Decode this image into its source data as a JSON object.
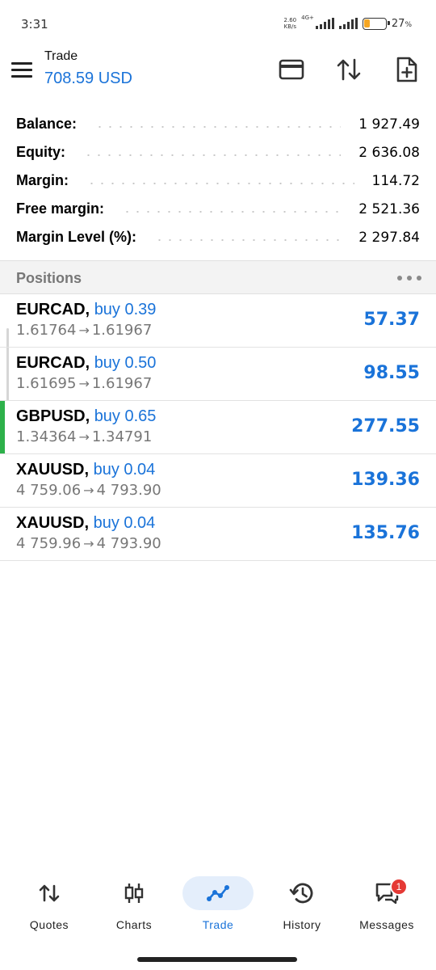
{
  "status_bar": {
    "time": "3:31",
    "net_speed_value": "2.60",
    "net_speed_unit": "KB/s",
    "net_type": "4G+",
    "battery_percent": "27",
    "battery_unit": "%",
    "battery_level": 0.27,
    "battery_color": "#f5a623"
  },
  "header": {
    "title": "Trade",
    "balance": "708.59 USD",
    "icons": [
      "card-icon",
      "sort-arrows-icon",
      "new-order-icon"
    ]
  },
  "summary": [
    {
      "label": "Balance:",
      "value": "1 927.49"
    },
    {
      "label": "Equity:",
      "value": "2 636.08"
    },
    {
      "label": "Margin:",
      "value": "114.72"
    },
    {
      "label": "Free margin:",
      "value": "2 521.36"
    },
    {
      "label": "Margin Level (%):",
      "value": "2 297.84"
    }
  ],
  "positions_section": {
    "title": "Positions",
    "items": [
      {
        "symbol": "EURCAD,",
        "side": "buy 0.39",
        "open": "1.61764",
        "current": "1.61967",
        "profit": "57.37"
      },
      {
        "symbol": "EURCAD,",
        "side": "buy 0.50",
        "open": "1.61695",
        "current": "1.61967",
        "profit": "98.55"
      },
      {
        "symbol": "GBPUSD,",
        "side": "buy 0.65",
        "open": "1.34364",
        "current": "1.34791",
        "profit": "277.55"
      },
      {
        "symbol": "XAUUSD,",
        "side": "buy 0.04",
        "open": "4 759.06",
        "current": "4 793.90",
        "profit": "139.36"
      },
      {
        "symbol": "XAUUSD,",
        "side": "buy 0.04",
        "open": "4 759.96",
        "current": "4 793.90",
        "profit": "135.76"
      }
    ]
  },
  "bottom_nav": {
    "items": [
      {
        "label": "Quotes",
        "icon": "quotes-icon"
      },
      {
        "label": "Charts",
        "icon": "charts-icon"
      },
      {
        "label": "Trade",
        "icon": "trade-icon",
        "active": true
      },
      {
        "label": "History",
        "icon": "history-icon"
      },
      {
        "label": "Messages",
        "icon": "messages-icon",
        "badge": "1"
      }
    ]
  },
  "colors": {
    "accent": "#1a73d9",
    "active_position_marker": "#2db14a",
    "badge": "#e53935",
    "active_nav_bg": "#e4eefb"
  }
}
